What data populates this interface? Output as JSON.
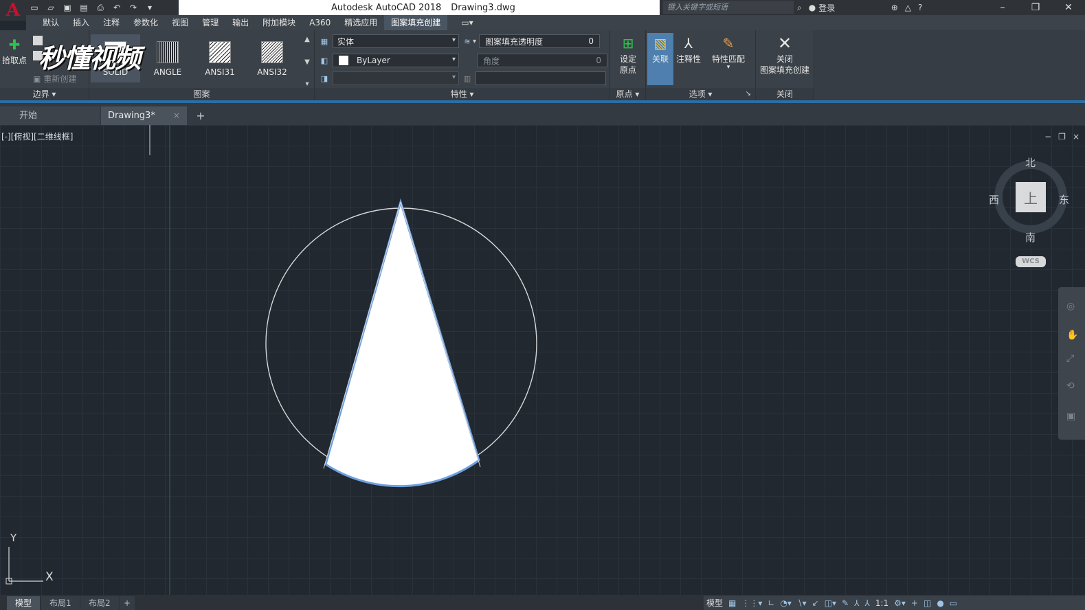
{
  "app": {
    "title": "Autodesk AutoCAD 2018",
    "document": "Drawing3.dwg",
    "search_placeholder": "键入关键字或短语",
    "login_label": "登录"
  },
  "menu": {
    "tabs": [
      "默认",
      "插入",
      "注释",
      "参数化",
      "视图",
      "管理",
      "输出",
      "附加模块",
      "A360",
      "精选应用",
      "图案填充创建"
    ],
    "active_index": 10
  },
  "watermark": "秒懂视频",
  "ribbon": {
    "boundary": {
      "pick_point_label": "拾取点",
      "recreate_label": "重新创建",
      "footer": "边界 ▾"
    },
    "pattern": {
      "tiles": [
        "SOLID",
        "ANGLE",
        "ANSI31",
        "ANSI32"
      ],
      "footer": "图案"
    },
    "properties": {
      "type_value": "实体",
      "color_value": "ByLayer",
      "transparency_label": "图案填充透明度",
      "transparency_value": "0",
      "angle_label": "角度",
      "angle_value": "0",
      "footer": "特性 ▾"
    },
    "origin": {
      "set_origin_label_1": "设定",
      "set_origin_label_2": "原点",
      "footer": "原点 ▾"
    },
    "options": {
      "associative_label": "关联",
      "annotative_label": "注释性",
      "match_props_label": "特性匹配",
      "footer": "选项 ▾",
      "footer_corner": "↘"
    },
    "close": {
      "label_1": "关闭",
      "label_2": "图案填充创建",
      "footer": "关闭"
    }
  },
  "doc_tabs": {
    "start": "开始",
    "drawing": "Drawing3*",
    "close": "×",
    "new": "+"
  },
  "viewport": {
    "label": "[-][俯视][二维线框]",
    "controls": [
      "−",
      "❐",
      "×"
    ],
    "viewcube": {
      "north": "北",
      "south": "南",
      "east": "东",
      "west": "西",
      "top": "上",
      "wcs": "WCS"
    },
    "ucs": {
      "x": "X",
      "y": "Y"
    }
  },
  "status": {
    "layouts": [
      "模型",
      "布局1",
      "布局2"
    ],
    "add": "+",
    "scale": "1:1"
  },
  "colors": {
    "canvas": "#212830",
    "accent": "#2c6ea3",
    "hatch_fill": "#ffffff",
    "selection": "#6fa0e0"
  }
}
